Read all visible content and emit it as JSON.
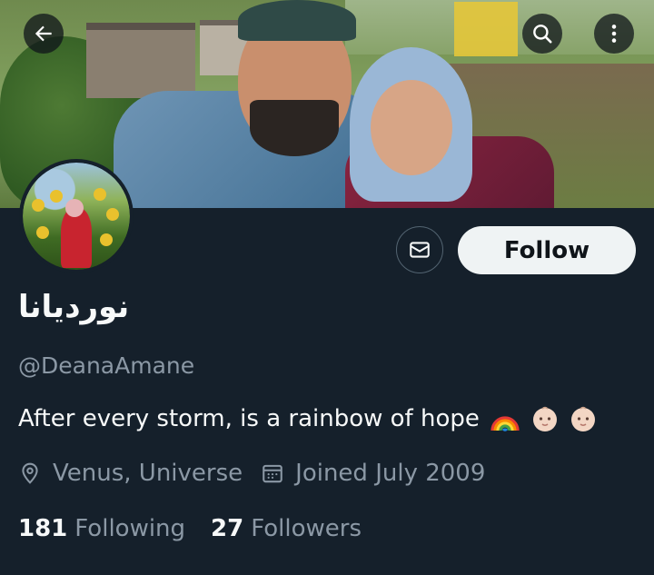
{
  "profile": {
    "display_name": "نورديانا",
    "handle": "@DeanaAmane",
    "bio": "After every storm, is a rainbow of hope",
    "bio_emoji": [
      "rainbow",
      "baby",
      "baby"
    ],
    "location": "Venus, Universe",
    "joined": "Joined July 2009",
    "following_count": "181",
    "following_label": "Following",
    "followers_count": "27",
    "followers_label": "Followers"
  },
  "actions": {
    "follow_label": "Follow"
  },
  "icons": {
    "back": "arrow-left-icon",
    "search": "search-icon",
    "more": "more-vertical-icon",
    "message": "mail-icon",
    "location": "location-pin-icon",
    "joined": "calendar-icon"
  },
  "colors": {
    "background": "#15202b",
    "text_primary": "#f7f9f9",
    "text_secondary": "#8b98a5",
    "follow_button_bg": "#eff3f4",
    "follow_button_text": "#0f1419",
    "border": "#536471"
  }
}
